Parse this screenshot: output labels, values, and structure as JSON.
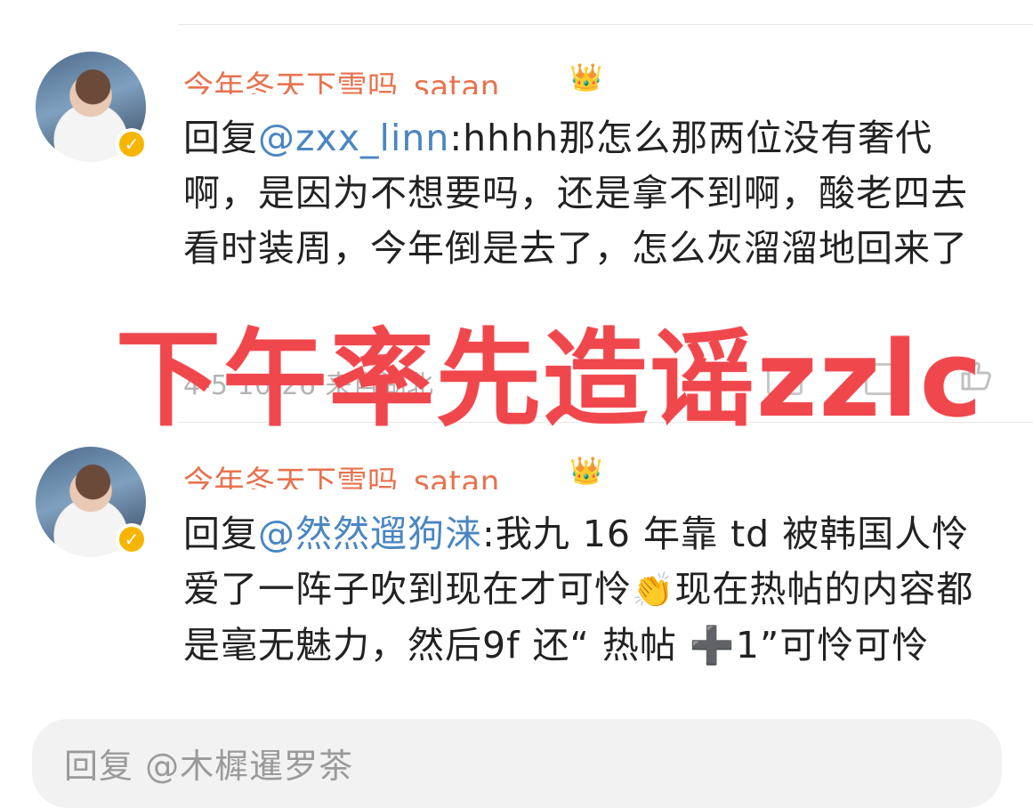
{
  "comments": [
    {
      "username": "今年冬天下雪吗_satan",
      "reply_prefix": "回复",
      "mention": "@zxx_linn",
      "text": ":hhhh那怎么那两位没有奢代啊，是因为不想要吗，还是拿不到啊，酸老四去看时装周，今年倒是去了，怎么灰溜溜地回来了",
      "meta": "4-5 10:26 来自湖北"
    },
    {
      "username": "今年冬天下雪吗_satan",
      "reply_prefix": "回复",
      "mention": "@然然遛狗涞",
      "text_before_emoji": ":我九 16 年靠 td 被韩国人怜爱了一阵子吹到现在才可怜",
      "emoji": "👏",
      "text_after_emoji": "现在热帖的内容都是毫无魅力，然后9f 还“ 热帖 ➕1”可怜可怜"
    }
  ],
  "watermark": "下午率先造谣zzlc",
  "reply_input": {
    "placeholder": "回复 @木樨暹罗茶"
  },
  "colors": {
    "username": "#e8724f",
    "mention": "#4a86c1",
    "watermark": "#f0474d",
    "badge": "#f7b500"
  },
  "icons": [
    "verified-badge-icon",
    "crown-icon",
    "like-icon",
    "comment-icon"
  ]
}
